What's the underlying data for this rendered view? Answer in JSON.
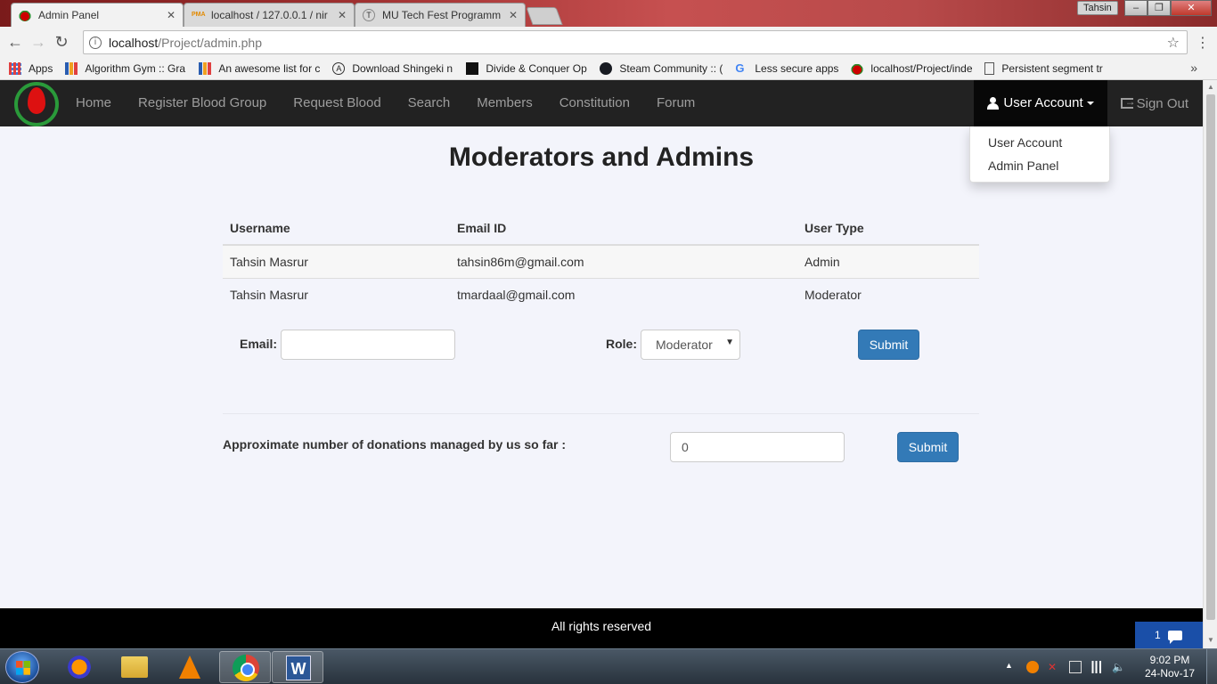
{
  "browser": {
    "tabs": [
      {
        "title": "Admin Panel",
        "active": true,
        "icon": "blood-drop-favicon"
      },
      {
        "title": "localhost / 127.0.0.1 / nir",
        "active": false,
        "icon": "phpmyadmin-favicon"
      },
      {
        "title": "MU Tech Fest Programm",
        "active": false,
        "icon": "mu-favicon"
      }
    ],
    "profile_name": "Tahsin",
    "url_host": "localhost",
    "url_path": "/Project/admin.php",
    "bookmarks": [
      {
        "label": "Apps",
        "icon": "apps-grid-icon"
      },
      {
        "label": "Algorithm Gym :: Gra",
        "icon": "bar-chart-icon"
      },
      {
        "label": "An awesome list for c",
        "icon": "bar-chart-icon"
      },
      {
        "label": "Download Shingeki n",
        "icon": "a-logo-icon"
      },
      {
        "label": "Divide & Conquer Op",
        "icon": "dc-icon"
      },
      {
        "label": "Steam Community :: (",
        "icon": "steam-icon"
      },
      {
        "label": "Less secure apps",
        "icon": "google-icon"
      },
      {
        "label": "localhost/Project/inde",
        "icon": "blood-drop-icon"
      },
      {
        "label": "Persistent segment tr",
        "icon": "page-icon"
      }
    ]
  },
  "navbar": {
    "items": [
      "Home",
      "Register Blood Group",
      "Request Blood",
      "Search",
      "Members",
      "Constitution",
      "Forum"
    ],
    "user_account": "User Account",
    "sign_out": "Sign Out",
    "dropdown": [
      "User Account",
      "Admin Panel"
    ]
  },
  "main": {
    "title": "Moderators and Admins",
    "table": {
      "headers": [
        "Username",
        "Email ID",
        "User Type"
      ],
      "rows": [
        [
          "Tahsin Masrur",
          "tahsin86m@gmail.com",
          "Admin"
        ],
        [
          "Tahsin Masrur",
          "tmardaal@gmail.com",
          "Moderator"
        ]
      ]
    },
    "role_form": {
      "email_label": "Email:",
      "email_value": "",
      "role_label": "Role:",
      "role_selected": "Moderator",
      "submit_label": "Submit"
    },
    "donations_form": {
      "label": "Approximate number of donations managed by us so far :",
      "value": "0",
      "submit_label": "Submit"
    },
    "footer": "All rights reserved",
    "chat_count": "1"
  },
  "taskbar": {
    "apps": [
      "firefox",
      "file-explorer",
      "vlc",
      "chrome",
      "word"
    ],
    "time": "9:02 PM",
    "date": "24-Nov-17"
  }
}
